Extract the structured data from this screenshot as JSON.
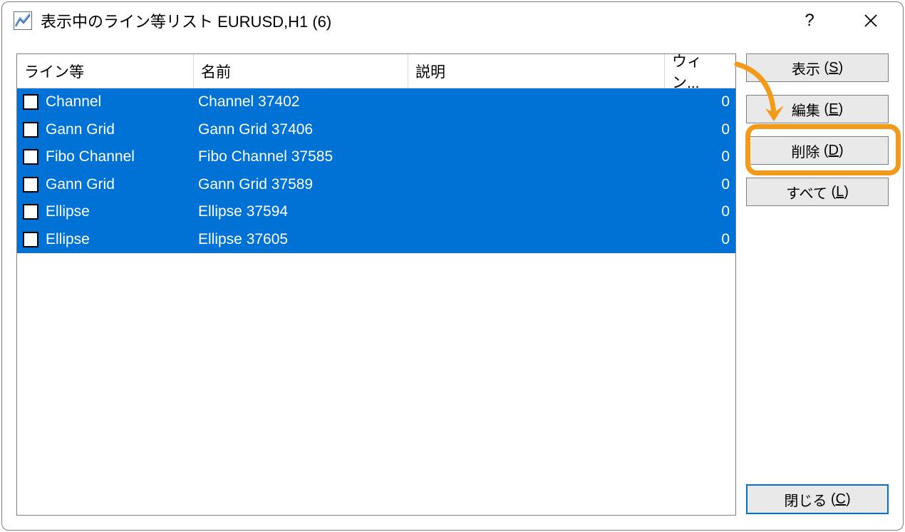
{
  "window": {
    "title": "表示中のライン等リスト EURUSD,H1 (6)"
  },
  "table": {
    "headers": {
      "line": "ライン等",
      "name": "名前",
      "desc": "説明",
      "window": "ウィン..."
    },
    "rows": [
      {
        "line": "Channel",
        "name": "Channel 37402",
        "desc": "",
        "window": "0"
      },
      {
        "line": "Gann Grid",
        "name": "Gann Grid 37406",
        "desc": "",
        "window": "0"
      },
      {
        "line": "Fibo Channel",
        "name": "Fibo Channel 37585",
        "desc": "",
        "window": "0"
      },
      {
        "line": "Gann Grid",
        "name": "Gann Grid 37589",
        "desc": "",
        "window": "0"
      },
      {
        "line": "Ellipse",
        "name": "Ellipse 37594",
        "desc": "",
        "window": "0"
      },
      {
        "line": "Ellipse",
        "name": "Ellipse 37605",
        "desc": "",
        "window": "0"
      }
    ]
  },
  "buttons": {
    "show": {
      "label": "表示",
      "hotkey": "S"
    },
    "edit": {
      "label": "編集",
      "hotkey": "E"
    },
    "delete": {
      "label": "削除",
      "hotkey": "D"
    },
    "all": {
      "label": "すべて",
      "hotkey": "L"
    },
    "close": {
      "label": "閉じる",
      "hotkey": "C"
    }
  },
  "titlebar": {
    "help": "?",
    "close": "×"
  }
}
